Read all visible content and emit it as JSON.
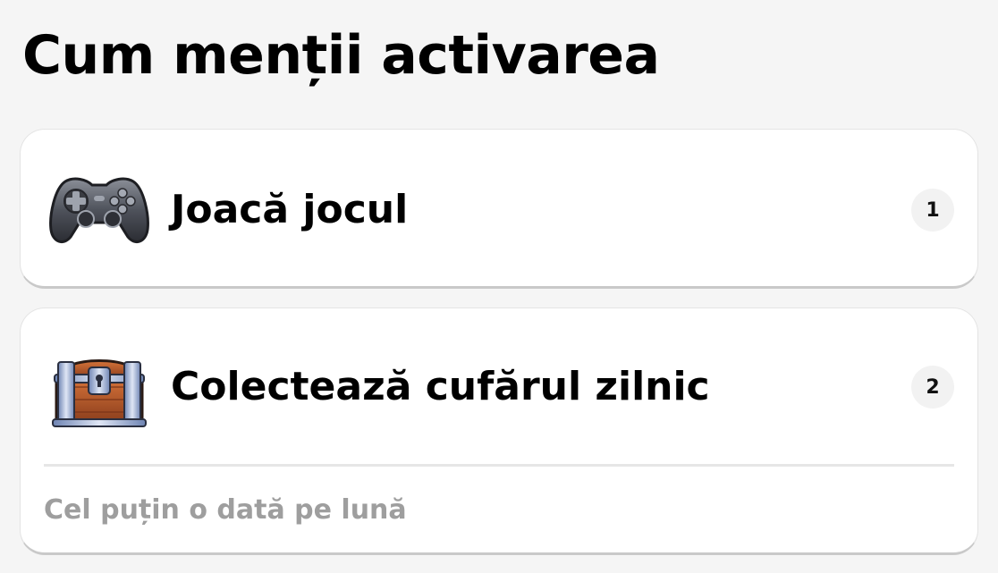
{
  "header": {
    "title": "Cum menții activarea"
  },
  "steps": [
    {
      "icon": "gamepad-icon",
      "label": "Joacă jocul",
      "number": "1"
    },
    {
      "icon": "treasure-chest-icon",
      "label": "Colectează cufărul zilnic",
      "number": "2",
      "note": "Cel puțin o dată pe lună"
    }
  ],
  "colors": {
    "background": "#f5f5f5",
    "card": "#ffffff",
    "text": "#000000",
    "muted_text": "#9e9e9e",
    "badge_bg": "#f2f2f2",
    "chest_wood": "#b0562a",
    "chest_metal": "#8fa3c9",
    "gamepad": "#4a4d55"
  }
}
